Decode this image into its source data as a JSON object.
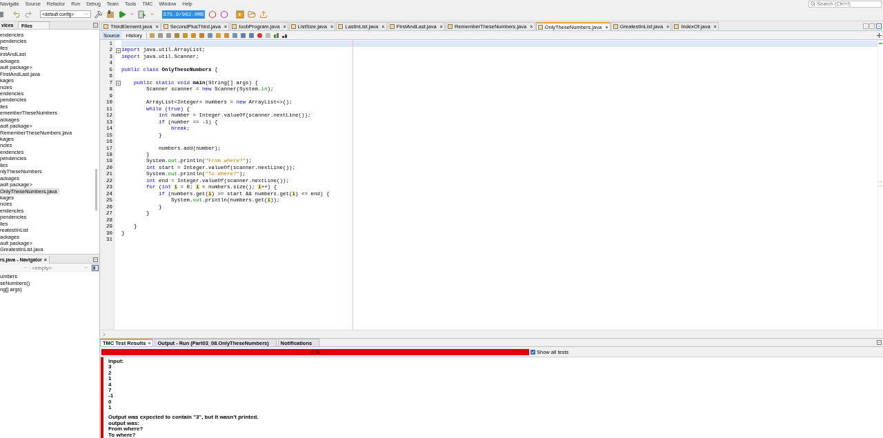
{
  "menu": [
    {
      "label": "Navigate"
    },
    {
      "label": "Source"
    },
    {
      "label": "Refactor"
    },
    {
      "label": "Run"
    },
    {
      "label": "Debug"
    },
    {
      "label": "Team"
    },
    {
      "label": "Tools"
    },
    {
      "label": "TMC"
    },
    {
      "label": "Window"
    },
    {
      "label": "Help"
    }
  ],
  "search": {
    "placeholder": "Search (Ctrl+I)"
  },
  "toolbar": {
    "config": "<default config>",
    "memory": "875.9/962.0MB"
  },
  "explorer": {
    "tabs": [
      {
        "label": "vices",
        "selected": false
      },
      {
        "label": "Files",
        "selected": true
      }
    ],
    "items": [
      {
        "label": "endencies",
        "selected": false
      },
      {
        "label": "pendencies",
        "selected": false
      },
      {
        "label": "iles",
        "selected": false
      },
      {
        "label": "irstAndLast",
        "selected": false
      },
      {
        "label": "ackages",
        "selected": false
      },
      {
        "label": "ault package>",
        "selected": false
      },
      {
        "label": "FirstAndLast.java",
        "selected": false
      },
      {
        "label": "kages",
        "selected": false
      },
      {
        "label": "ncies",
        "selected": false
      },
      {
        "label": "endencies",
        "selected": false
      },
      {
        "label": "pendencies",
        "selected": false
      },
      {
        "label": "iles",
        "selected": false
      },
      {
        "label": "ememberTheseNumbers",
        "selected": false
      },
      {
        "label": "ackages",
        "selected": false
      },
      {
        "label": "ault package>",
        "selected": false
      },
      {
        "label": "RememberTheseNumbers.java",
        "selected": false
      },
      {
        "label": "kages",
        "selected": false
      },
      {
        "label": "ncies",
        "selected": false
      },
      {
        "label": "endencies",
        "selected": false
      },
      {
        "label": "pendencies",
        "selected": false
      },
      {
        "label": "iles",
        "selected": false
      },
      {
        "label": "nlyTheseNumbers",
        "selected": false
      },
      {
        "label": "ackages",
        "selected": false
      },
      {
        "label": "ault package>",
        "selected": false
      },
      {
        "label": "OnlyTheseNumbers.java",
        "selected": true
      },
      {
        "label": "kages",
        "selected": false
      },
      {
        "label": "ncies",
        "selected": false
      },
      {
        "label": "endencies",
        "selected": false
      },
      {
        "label": "pendencies",
        "selected": false
      },
      {
        "label": "iles",
        "selected": false
      },
      {
        "label": "reatestInList",
        "selected": false
      },
      {
        "label": "ackages",
        "selected": false
      },
      {
        "label": "ault package>",
        "selected": false
      },
      {
        "label": "GreatestInList.java",
        "selected": false
      }
    ]
  },
  "navigator": {
    "title": "rs.java - Navigator",
    "close": "×",
    "filter": "<empty>",
    "items": [
      {
        "label": "umbers"
      },
      {
        "label": "seNumbers()"
      },
      {
        "label": "ng[] args)"
      }
    ]
  },
  "editor_tabs": [
    {
      "label": "ThirdElement.java",
      "selected": false
    },
    {
      "label": "SecondPlusThird.java",
      "selected": false
    },
    {
      "label": "IoobProgram.java",
      "selected": false
    },
    {
      "label": "ListSize.java",
      "selected": false
    },
    {
      "label": "LastInList.java",
      "selected": false
    },
    {
      "label": "FirstAndLast.java",
      "selected": false
    },
    {
      "label": "RememberTheseNumbers.java",
      "selected": false
    },
    {
      "label": "OnlyTheseNumbers.java",
      "selected": true
    },
    {
      "label": "GreatestInList.java",
      "selected": false
    },
    {
      "label": "IndexOf.java",
      "selected": false
    }
  ],
  "tab_close": "×",
  "view_tabs": [
    {
      "label": "Source",
      "selected": true
    },
    {
      "label": "History",
      "selected": false
    }
  ],
  "code": [
    {
      "n": "1",
      "current": true,
      "fold": false
    },
    {
      "n": "2",
      "current": false,
      "fold": true,
      "tokens": [
        {
          "kind": "kw",
          "text": "import"
        },
        {
          "kind": "plain",
          "text": " java.util.ArrayList;"
        }
      ]
    },
    {
      "n": "3",
      "current": false,
      "fold": false,
      "tokens": [
        {
          "kind": "kw",
          "text": "import"
        },
        {
          "kind": "plain",
          "text": " java.util.Scanner;"
        }
      ]
    },
    {
      "n": "4",
      "current": false,
      "fold": false
    },
    {
      "n": "5",
      "current": false,
      "fold": false,
      "tokens": [
        {
          "kind": "kw",
          "text": "public class "
        },
        {
          "kind": "bold",
          "text": "OnlyTheseNumbers"
        },
        {
          "kind": "plain",
          "text": " {"
        }
      ]
    },
    {
      "n": "6",
      "current": false,
      "fold": false
    },
    {
      "n": "7",
      "current": false,
      "fold": true,
      "tokens": [
        {
          "kind": "kw",
          "text": "    public static void "
        },
        {
          "kind": "bold",
          "text": "main"
        },
        {
          "kind": "plain",
          "text": "(String[] args) {"
        }
      ]
    },
    {
      "n": "8",
      "current": false,
      "fold": false,
      "tokens": [
        {
          "kind": "plain",
          "text": "        Scanner scanner = "
        },
        {
          "kind": "kw",
          "text": "new"
        },
        {
          "kind": "plain",
          "text": " Scanner(System."
        },
        {
          "kind": "field",
          "text": "in"
        },
        {
          "kind": "plain",
          "text": ");"
        }
      ]
    },
    {
      "n": "9",
      "current": false,
      "fold": false
    },
    {
      "n": "10",
      "current": false,
      "fold": false,
      "tokens": [
        {
          "kind": "plain",
          "text": "        ArrayList<Integer> numbers = "
        },
        {
          "kind": "kw",
          "text": "new"
        },
        {
          "kind": "plain",
          "text": " ArrayList<>();"
        }
      ]
    },
    {
      "n": "11",
      "current": false,
      "fold": false,
      "tokens": [
        {
          "kind": "kw",
          "text": "        while"
        },
        {
          "kind": "plain",
          "text": " ("
        },
        {
          "kind": "kw",
          "text": "true"
        },
        {
          "kind": "plain",
          "text": ") {"
        }
      ]
    },
    {
      "n": "12",
      "current": false,
      "fold": false,
      "tokens": [
        {
          "kind": "kw",
          "text": "            int"
        },
        {
          "kind": "plain",
          "text": " number = Integer.valueOf(scanner.nextLine());"
        }
      ]
    },
    {
      "n": "13",
      "current": false,
      "fold": false,
      "tokens": [
        {
          "kind": "kw",
          "text": "            if"
        },
        {
          "kind": "plain",
          "text": " (number == -1) {"
        }
      ]
    },
    {
      "n": "14",
      "current": false,
      "fold": false,
      "tokens": [
        {
          "kind": "kw",
          "text": "                break"
        },
        {
          "kind": "plain",
          "text": ";"
        }
      ]
    },
    {
      "n": "15",
      "current": false,
      "fold": false,
      "tokens": [
        {
          "kind": "plain",
          "text": "            }"
        }
      ]
    },
    {
      "n": "16",
      "current": false,
      "fold": false
    },
    {
      "n": "17",
      "current": false,
      "fold": false,
      "tokens": [
        {
          "kind": "plain",
          "text": "            numbers.add(number);"
        }
      ]
    },
    {
      "n": "18",
      "current": false,
      "fold": false,
      "tokens": [
        {
          "kind": "plain",
          "text": "        }"
        }
      ]
    },
    {
      "n": "19",
      "current": false,
      "fold": false,
      "tokens": [
        {
          "kind": "plain",
          "text": "        System."
        },
        {
          "kind": "field",
          "text": "out"
        },
        {
          "kind": "plain",
          "text": ".println("
        },
        {
          "kind": "str",
          "text": "\"From where?\""
        },
        {
          "kind": "plain",
          "text": ");"
        }
      ]
    },
    {
      "n": "20",
      "current": false,
      "fold": false,
      "tokens": [
        {
          "kind": "kw",
          "text": "        int"
        },
        {
          "kind": "plain",
          "text": " start = Integer.valueOf(scanner.nextLine());"
        }
      ]
    },
    {
      "n": "21",
      "current": false,
      "fold": false,
      "tokens": [
        {
          "kind": "plain",
          "text": "        System."
        },
        {
          "kind": "field",
          "text": "out"
        },
        {
          "kind": "plain",
          "text": ".println("
        },
        {
          "kind": "str",
          "text": "\"To where?\""
        },
        {
          "kind": "plain",
          "text": ");"
        }
      ]
    },
    {
      "n": "22",
      "current": false,
      "fold": false,
      "tokens": [
        {
          "kind": "kw",
          "text": "        int"
        },
        {
          "kind": "plain",
          "text": " end = Integer.valueOf(scanner.nextLine());"
        }
      ]
    },
    {
      "n": "23",
      "current": false,
      "fold": false,
      "tokens": [
        {
          "kind": "kw",
          "text": "        for"
        },
        {
          "kind": "plain",
          "text": " ("
        },
        {
          "kind": "kw",
          "text": "int "
        },
        {
          "kind": "hl",
          "text": "i"
        },
        {
          "kind": "plain",
          "text": " = 0; "
        },
        {
          "kind": "hl",
          "text": "i"
        },
        {
          "kind": "plain",
          "text": " < numbers.size(); "
        },
        {
          "kind": "hl",
          "text": "i"
        },
        {
          "kind": "plain",
          "text": "++) {"
        }
      ]
    },
    {
      "n": "24",
      "current": false,
      "fold": false,
      "tokens": [
        {
          "kind": "kw",
          "text": "            if"
        },
        {
          "kind": "plain",
          "text": " (numbers.get("
        },
        {
          "kind": "hl",
          "text": "i"
        },
        {
          "kind": "plain",
          "text": ") >= start && numbers.get("
        },
        {
          "kind": "hl",
          "text": "i"
        },
        {
          "kind": "plain",
          "text": ") <= end) {"
        }
      ]
    },
    {
      "n": "25",
      "current": false,
      "fold": false,
      "tokens": [
        {
          "kind": "plain",
          "text": "                System."
        },
        {
          "kind": "field",
          "text": "out"
        },
        {
          "kind": "plain",
          "text": ".println(numbers.get("
        },
        {
          "kind": "hl",
          "text": "i"
        },
        {
          "kind": "plain",
          "text": "));"
        }
      ]
    },
    {
      "n": "26",
      "current": false,
      "fold": false,
      "tokens": [
        {
          "kind": "plain",
          "text": "            }"
        }
      ]
    },
    {
      "n": "27",
      "current": false,
      "fold": false,
      "tokens": [
        {
          "kind": "plain",
          "text": "        }"
        }
      ]
    },
    {
      "n": "28",
      "current": false,
      "fold": false
    },
    {
      "n": "29",
      "current": false,
      "fold": false,
      "tokens": [
        {
          "kind": "plain",
          "text": "    }"
        }
      ]
    },
    {
      "n": "30",
      "current": false,
      "fold": false,
      "tokens": [
        {
          "kind": "plain",
          "text": "}"
        }
      ]
    },
    {
      "n": "31",
      "current": false,
      "fold": false
    }
  ],
  "bottom_tabs": [
    {
      "label": "TMC Test Results",
      "selected": true,
      "closable": true
    },
    {
      "label": "Output - Run (Part03_08.OnlyTheseNumbers)",
      "selected": false,
      "closable": false
    },
    {
      "label": "Notifications",
      "selected": false,
      "closable": false
    }
  ],
  "test_results": {
    "progress": {
      "level": 0,
      "label": "0 %"
    },
    "show_all": {
      "label": "Show all tests",
      "checked": true
    },
    "failed": true,
    "input_lines": [
      "Input:",
      "3",
      "2",
      "1",
      "4",
      "7",
      "-1",
      "0",
      "1"
    ],
    "result_lines": [
      "Output was expected to contain \"3\", but it wasn't printed.",
      "output was:",
      "From where?",
      "To where?"
    ]
  }
}
